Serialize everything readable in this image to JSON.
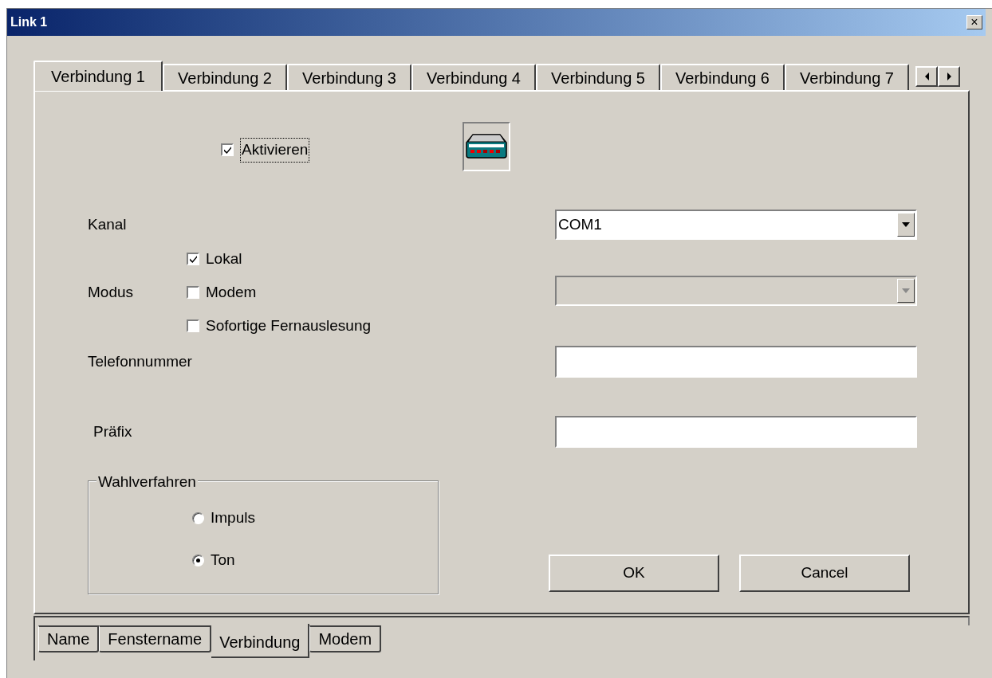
{
  "window": {
    "title": "Link 1",
    "close": "×"
  },
  "tabs": [
    {
      "label": "Verbindung 1",
      "selected": true
    },
    {
      "label": "Verbindung 2",
      "selected": false
    },
    {
      "label": "Verbindung 3",
      "selected": false
    },
    {
      "label": "Verbindung 4",
      "selected": false
    },
    {
      "label": "Verbindung 5",
      "selected": false
    },
    {
      "label": "Verbindung 6",
      "selected": false
    },
    {
      "label": "Verbindung 7",
      "selected": false
    }
  ],
  "activate": {
    "label": "Aktivieren",
    "checked": true
  },
  "channel": {
    "label": "Kanal",
    "value": "COM1",
    "disabled": false
  },
  "mode": {
    "label": "Modus",
    "options": [
      {
        "label": "Lokal",
        "checked": true
      },
      {
        "label": "Modem",
        "checked": false
      },
      {
        "label": "Sofortige Fernauslesung",
        "checked": false
      }
    ]
  },
  "modem_select": {
    "disabled": true
  },
  "phone": {
    "label": "Telefonnummer"
  },
  "prefix": {
    "label": "Präfix"
  },
  "dialing": {
    "title": "Wahlverfahren",
    "options": [
      {
        "label": "Impuls",
        "selected": false
      },
      {
        "label": "Ton",
        "selected": true
      }
    ]
  },
  "buttons": [
    "OK",
    "Cancel"
  ],
  "bottom_tabs": [
    {
      "label": "Name",
      "selected": false
    },
    {
      "label": "Fenstername",
      "selected": false
    },
    {
      "label": "Verbindung",
      "selected": true
    },
    {
      "label": "Modem",
      "selected": false
    }
  ]
}
